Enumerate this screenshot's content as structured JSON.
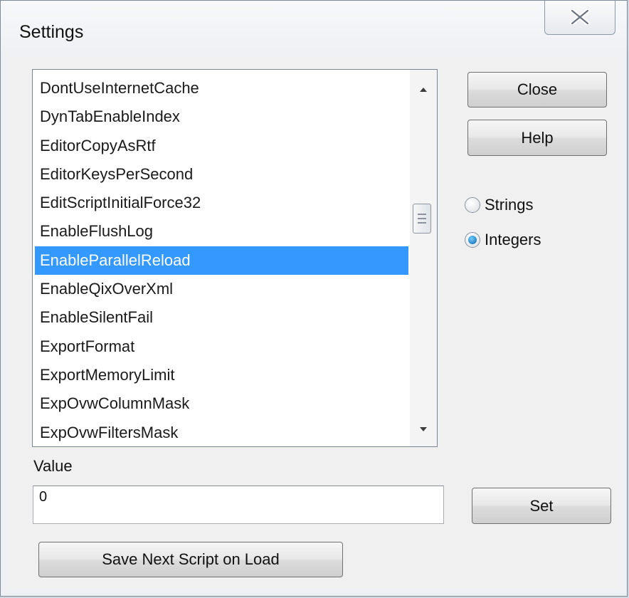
{
  "window": {
    "title": "Settings"
  },
  "list": {
    "items": [
      "DontUseInternetCache",
      "DynTabEnableIndex",
      "EditorCopyAsRtf",
      "EditorKeysPerSecond",
      "EditScriptInitialForce32",
      "EnableFlushLog",
      "EnableParallelReload",
      "EnableQixOverXml",
      "EnableSilentFail",
      "ExportFormat",
      "ExportMemoryLimit",
      "ExpOvwColumnMask",
      "ExpOvwFiltersMask"
    ],
    "selected_index": 6
  },
  "buttons": {
    "close": "Close",
    "help": "Help",
    "set": "Set",
    "save_next_script": "Save Next Script on Load"
  },
  "type_options": {
    "strings": "Strings",
    "integers": "Integers",
    "selected": "integers"
  },
  "value": {
    "label": "Value",
    "current": "0"
  },
  "colors": {
    "selection": "#3399ff",
    "radio_accent": "#0b5fa8"
  }
}
